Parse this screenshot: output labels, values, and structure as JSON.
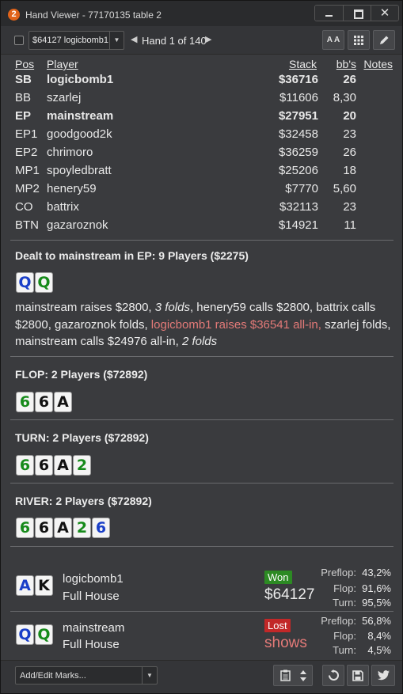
{
  "window": {
    "app_icon_text": "2",
    "title": "Hand Viewer - 77170135 table 2",
    "close_glyph": "✕"
  },
  "toolbar": {
    "hand_select_value": "$64127 logicbomb1",
    "hand_label": "Hand 1 of 140",
    "font_button": "A A",
    "grid_icon": "grid-icon",
    "edit_icon": "pencil-icon"
  },
  "players": {
    "headers": {
      "pos": "Pos",
      "player": "Player",
      "stack": "Stack",
      "bbs": "bb's",
      "notes": "Notes"
    },
    "rows": [
      {
        "pos": "SB",
        "name": "logicbomb1",
        "stack": "$36716",
        "bbs": "26",
        "bold": true
      },
      {
        "pos": "BB",
        "name": "szarlej",
        "stack": "$11606",
        "bbs": "8,30",
        "bold": false
      },
      {
        "pos": "EP",
        "name": "mainstream",
        "stack": "$27951",
        "bbs": "20",
        "bold": true
      },
      {
        "pos": "EP1",
        "name": "goodgood2k",
        "stack": "$32458",
        "bbs": "23",
        "bold": false
      },
      {
        "pos": "EP2",
        "name": "chrimoro",
        "stack": "$36259",
        "bbs": "26",
        "bold": false
      },
      {
        "pos": "MP1",
        "name": "spoyledbratt",
        "stack": "$25206",
        "bbs": "18",
        "bold": false
      },
      {
        "pos": "MP2",
        "name": "henery59",
        "stack": "$7770",
        "bbs": "5,60",
        "bold": false
      },
      {
        "pos": "CO",
        "name": "battrix",
        "stack": "$32113",
        "bbs": "23",
        "bold": false
      },
      {
        "pos": "BTN",
        "name": "gazaroznok",
        "stack": "$14921",
        "bbs": "11",
        "bold": false
      }
    ]
  },
  "preflop": {
    "title": "Dealt to mainstream in EP: 9 Players ($2275)",
    "cards": [
      {
        "rank": "Q",
        "color": "blue"
      },
      {
        "rank": "Q",
        "color": "green"
      }
    ],
    "action_1": "mainstream raises $2800, ",
    "action_2": "3 folds",
    "action_3": ", henery59 calls $2800, battrix calls $2800, gazaroznok folds, ",
    "action_4": "logicbomb1 raises $36541 all-in,",
    "action_5": " szarlej folds, mainstream calls $24976 all-in, ",
    "action_6": "2 folds"
  },
  "flop": {
    "title": "FLOP: 2 Players ($72892)",
    "cards": [
      {
        "rank": "6",
        "color": "green"
      },
      {
        "rank": "6",
        "color": "black"
      },
      {
        "rank": "A",
        "color": "black"
      }
    ]
  },
  "turn": {
    "title": "TURN: 2 Players ($72892)",
    "cards": [
      {
        "rank": "6",
        "color": "green"
      },
      {
        "rank": "6",
        "color": "black"
      },
      {
        "rank": "A",
        "color": "black"
      },
      {
        "rank": "2",
        "color": "green"
      }
    ]
  },
  "river": {
    "title": "RIVER: 2 Players ($72892)",
    "cards": [
      {
        "rank": "6",
        "color": "green"
      },
      {
        "rank": "6",
        "color": "black"
      },
      {
        "rank": "A",
        "color": "black"
      },
      {
        "rank": "2",
        "color": "green"
      },
      {
        "rank": "6",
        "color": "blue"
      }
    ]
  },
  "results": [
    {
      "cards": [
        {
          "rank": "A",
          "color": "blue"
        },
        {
          "rank": "K",
          "color": "black"
        }
      ],
      "name": "logicbomb1",
      "hand": "Full House",
      "badge": "Won",
      "amount": "$64127",
      "equity": [
        {
          "label": "Preflop:",
          "value": "43,2%"
        },
        {
          "label": "Flop:",
          "value": "91,6%"
        },
        {
          "label": "Turn:",
          "value": "95,5%"
        }
      ]
    },
    {
      "cards": [
        {
          "rank": "Q",
          "color": "blue"
        },
        {
          "rank": "Q",
          "color": "green"
        }
      ],
      "name": "mainstream",
      "hand": "Full House",
      "badge": "Lost",
      "amount": "shows",
      "equity": [
        {
          "label": "Preflop:",
          "value": "56,8%"
        },
        {
          "label": "Flop:",
          "value": "8,4%"
        },
        {
          "label": "Turn:",
          "value": "4,5%"
        }
      ]
    }
  ],
  "bottom": {
    "marks_value": "Add/Edit Marks..."
  },
  "colors": {
    "won": "#2c8a23",
    "lost": "#c22828",
    "highlight_red": "#e47a78",
    "card_blue": "#1a3fc8",
    "card_green": "#168a1a"
  }
}
